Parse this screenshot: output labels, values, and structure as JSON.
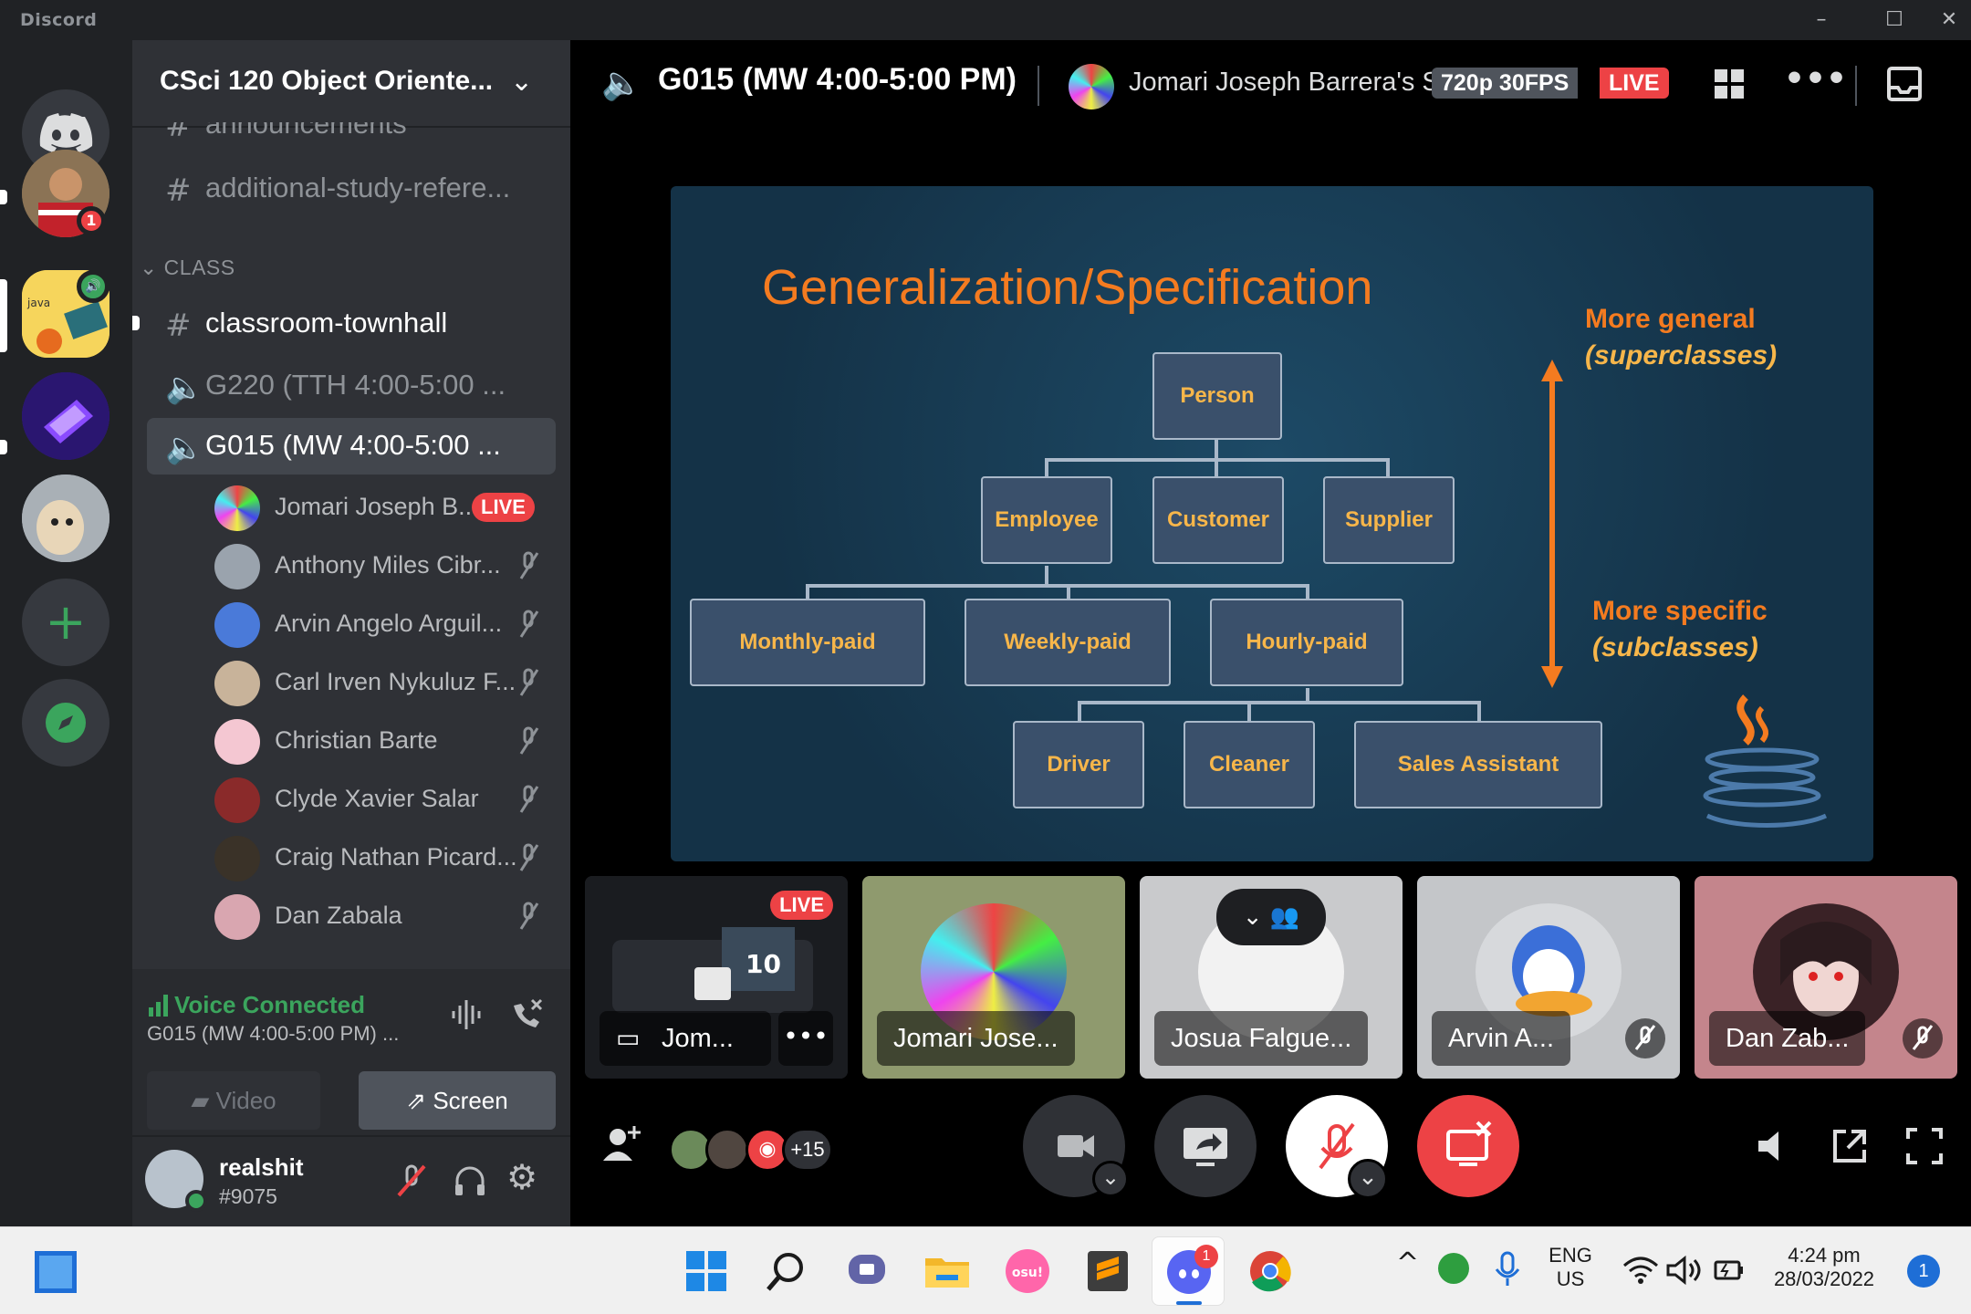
{
  "window": {
    "title": "Discord",
    "controls": [
      "minimize-icon",
      "maximize-icon",
      "close-icon"
    ]
  },
  "rail": {
    "servers": [
      {
        "name": "home",
        "icon": "discord-logo-icon"
      },
      {
        "name": "user-server",
        "badge": "1"
      },
      {
        "name": "java-server",
        "speaker": true
      },
      {
        "name": "purple-server"
      },
      {
        "name": "dog-server"
      }
    ],
    "add_icon": "plus-icon",
    "explore_icon": "compass-icon"
  },
  "sidebar": {
    "guild_name": "CSci 120 Object Oriente...",
    "channels_top": [
      {
        "label": "announcements",
        "type": "text"
      },
      {
        "label": "additional-study-refere...",
        "type": "text"
      }
    ],
    "category": "CLASS",
    "class_channels": [
      {
        "label": "classroom-townhall",
        "type": "text",
        "unread": true
      },
      {
        "label": "G220 (TTH 4:00-5:00 ...",
        "type": "voice"
      },
      {
        "label": "G015 (MW 4:00-5:00 ...",
        "type": "voice",
        "active": true
      }
    ],
    "voice_users": [
      {
        "name": "Jomari Joseph B...",
        "live": "LIVE"
      },
      {
        "name": "Anthony Miles Cibr..."
      },
      {
        "name": "Arvin Angelo Arguil..."
      },
      {
        "name": "Carl Irven Nykuluz F..."
      },
      {
        "name": "Christian Barte"
      },
      {
        "name": "Clyde Xavier Salar"
      },
      {
        "name": "Craig Nathan Picard..."
      },
      {
        "name": "Dan Zabala"
      }
    ],
    "voice_panel": {
      "status": "Voice Connected",
      "channel": "G015 (MW 4:00-5:00 PM) ...",
      "video_label": "Video",
      "screen_label": "Screen"
    },
    "user": {
      "name": "realshit",
      "tag": "#9075"
    }
  },
  "main": {
    "voice_title": "G015 (MW 4:00-5:00 PM)",
    "stream_title": "Jomari Joseph Barrera's S",
    "quality": "720p 30FPS",
    "live": "LIVE",
    "slide": {
      "title": "Generalization/Specification",
      "boxes": {
        "person": "Person",
        "employee": "Employee",
        "customer": "Customer",
        "supplier": "Supplier",
        "monthly": "Monthly-paid",
        "weekly": "Weekly-paid",
        "hourly": "Hourly-paid",
        "driver": "Driver",
        "cleaner": "Cleaner",
        "sales": "Sales Assistant"
      },
      "general_label": "More general",
      "general_sub": "(superclasses)",
      "specific_label": "More specific",
      "specific_sub": "(subclasses)"
    },
    "tiles": [
      {
        "name": "Jom...",
        "live": "LIVE",
        "tv_text": "10"
      },
      {
        "name": "Jomari Jose..."
      },
      {
        "name": "Josua Falgue..."
      },
      {
        "name": "Arvin A..."
      },
      {
        "name": "Dan Zab..."
      }
    ],
    "participants_more": "+15"
  },
  "taskbar": {
    "lang": "ENG",
    "region": "US",
    "time": "4:24 pm",
    "date": "28/03/2022",
    "notifications": "1",
    "discord_badge": "1"
  },
  "colors": {
    "accent_green": "#3ba55d",
    "live_red": "#ed4245",
    "slide_orange": "#f47b20",
    "blurple": "#5865f2"
  }
}
